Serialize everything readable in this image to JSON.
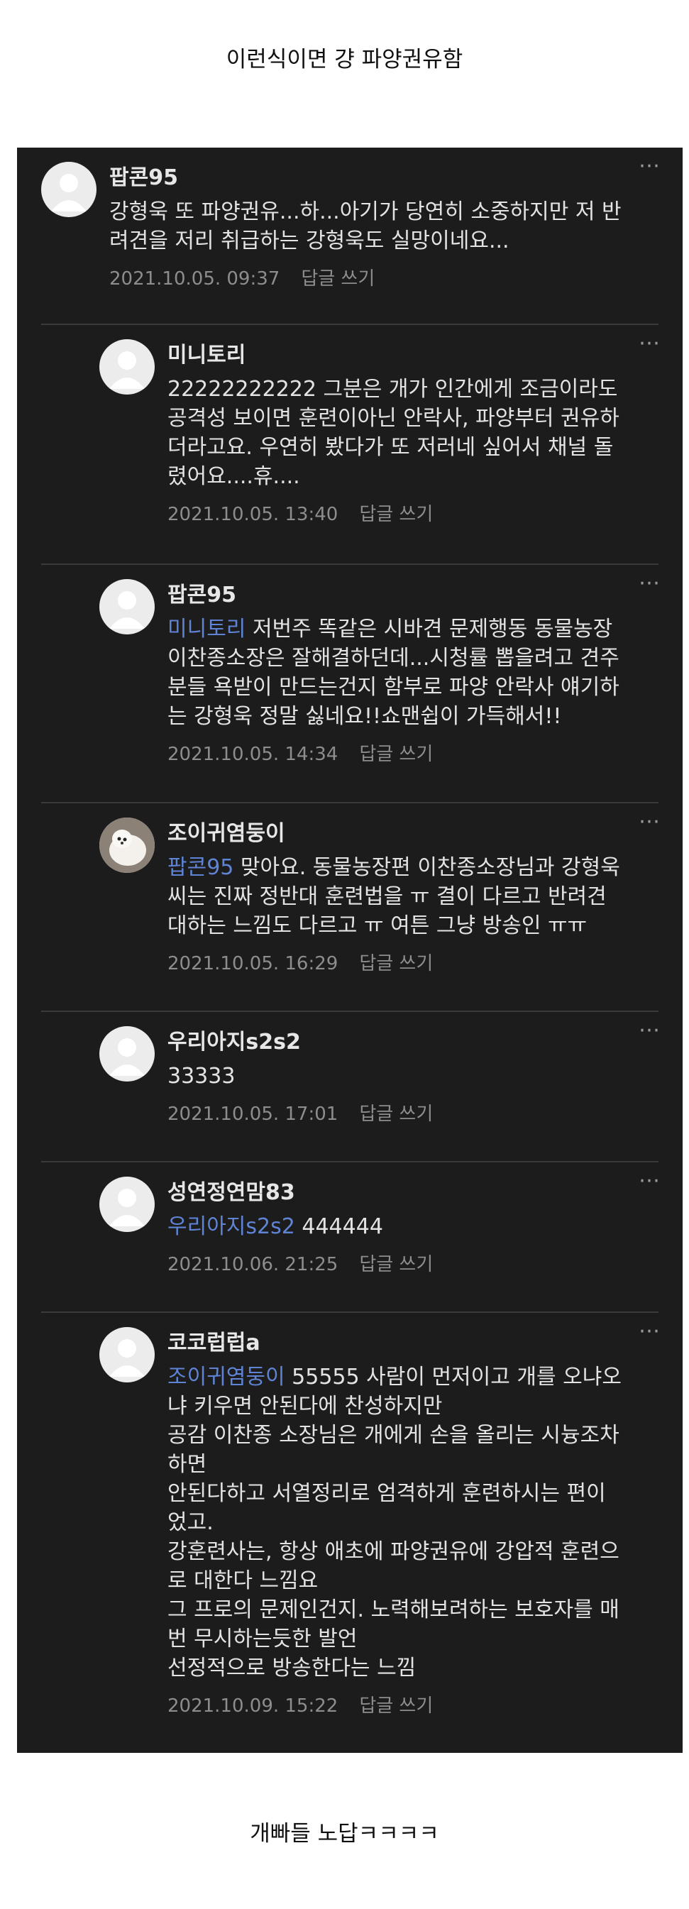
{
  "top_caption": "이런식이면 걍 파양권유함",
  "bottom_caption": "개빠들 노답ㅋㅋㅋㅋ",
  "more_icon": "⋯",
  "reply_label": "답글 쓰기",
  "comments": [
    {
      "author": "팝콘95",
      "mention": "",
      "text": "강형욱 또 파양권유...하...아기가 당연히 소중하지만 저 반\n려견을 저리 취급하는 강형욱도 실망이네요...",
      "date": "2021.10.05. 09:37"
    },
    {
      "author": "미니토리",
      "mention": "",
      "text": "22222222222 그분은 개가 인간에게 조금이라도\n공격성 보이면 훈련이아닌 안락사, 파양부터 권유하\n더라고요. 우연히 봤다가 또 저러네 싶어서 채널 돌\n렸어요....휴....",
      "date": "2021.10.05. 13:40"
    },
    {
      "author": "팝콘95",
      "mention": "미니토리",
      "text": " 저번주 똑같은 시바견 문제행동 동물농장\n이찬종소장은 잘해결하던데...시청률 뽑을려고 견주\n분들 욕받이 만드는건지 함부로 파양 안락사 얘기하\n는 강형욱 정말 싫네요!!쇼맨쉽이 가득해서!!",
      "date": "2021.10.05. 14:34"
    },
    {
      "author": "조이귀염둥이",
      "mention": "팝콘95",
      "text": " 맞아요. 동물농장편 이찬종소장님과 강형욱\n씨는 진짜 정반대 훈련법을 ㅠ 결이 다르고 반려견\n대하는 느낌도 다르고 ㅠ 여튼 그냥 방송인 ㅠㅠ",
      "date": "2021.10.05. 16:29"
    },
    {
      "author": "우리아지s2s2",
      "mention": "",
      "text": "33333",
      "date": "2021.10.05. 17:01"
    },
    {
      "author": "성연정연맘83",
      "mention": "우리아지s2s2",
      "text": " 444444",
      "date": "2021.10.06. 21:25"
    },
    {
      "author": "코코럽럽a",
      "mention": "조이귀염둥이",
      "text": " 55555 사람이 먼저이고 개를 오냐오\n냐 키우면 안된다에 찬성하지만\n공감 이찬종 소장님은 개에게 손을 올리는 시늉조차\n하면\n안된다하고 서열정리로 엄격하게 훈련하시는 편이\n었고.\n강훈련사는, 항상 애초에 파양권유에 강압적 훈련으\n로 대한다 느낌요\n그 프로의 문제인건지. 노력해보려하는 보호자를 매\n번 무시하는듯한 발언\n선정적으로 방송한다는 느낌",
      "date": "2021.10.09. 15:22"
    }
  ]
}
